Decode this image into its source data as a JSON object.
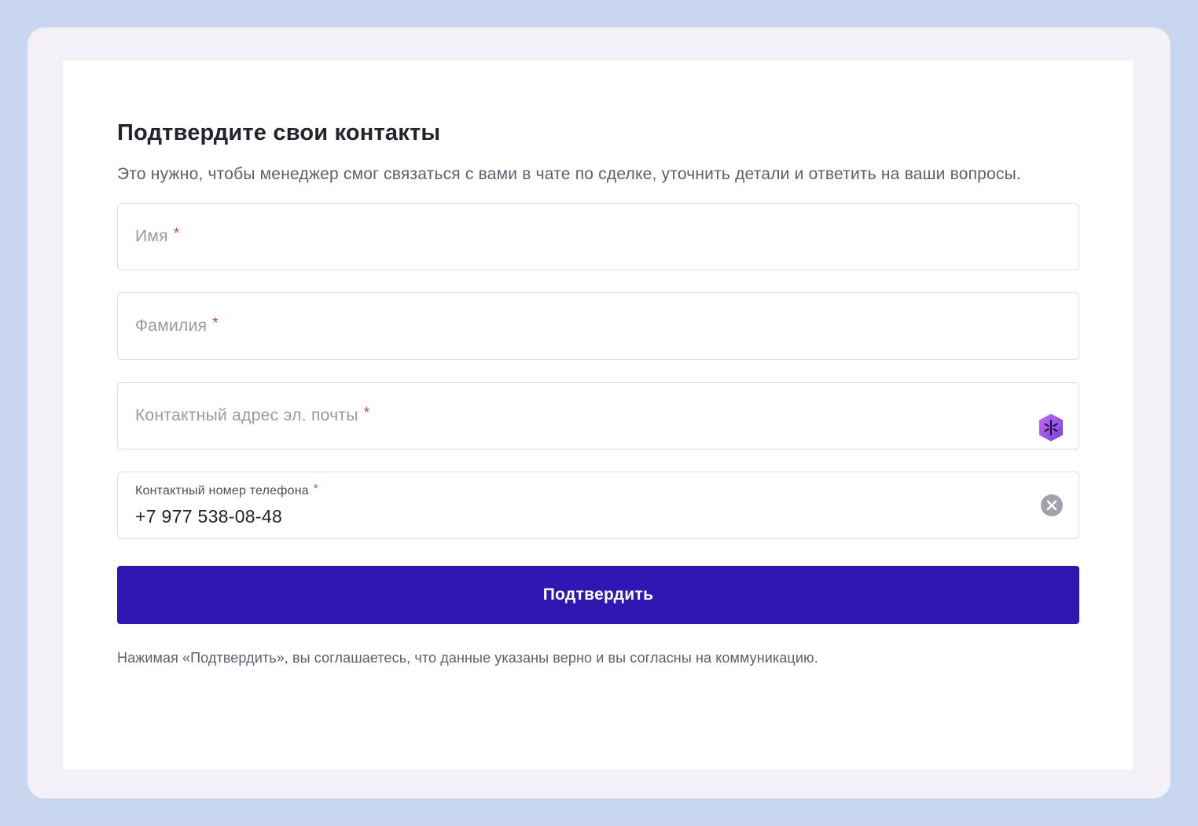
{
  "form": {
    "title": "Подтвердите свои контакты",
    "subtitle": "Это нужно, чтобы менеджер смог связаться с вами в чате по сделке, уточнить детали и ответить на ваши вопросы.",
    "required_mark": "*",
    "fields": {
      "first_name": {
        "placeholder": "Имя",
        "value": ""
      },
      "last_name": {
        "placeholder": "Фамилия",
        "value": ""
      },
      "email": {
        "placeholder": "Контактный адрес эл. почты",
        "value": "",
        "extension_icon": "sparkle-extension-icon"
      },
      "phone": {
        "label": "Контактный номер телефона",
        "value": "+7 977 538-08-48",
        "clear_icon": "clear-icon"
      }
    },
    "submit_label": "Подтвердить",
    "disclaimer": "Нажимая «Подтвердить», вы соглашаетесь, что данные указаны верно и вы согласны на коммуникацию."
  },
  "colors": {
    "page_background": "#c8d7ef",
    "frame_background": "#f3f1f7",
    "card_background": "#ffffff",
    "accent": "#2e17b3",
    "required": "#d2473a",
    "extension_icon": "#9b51e0"
  }
}
